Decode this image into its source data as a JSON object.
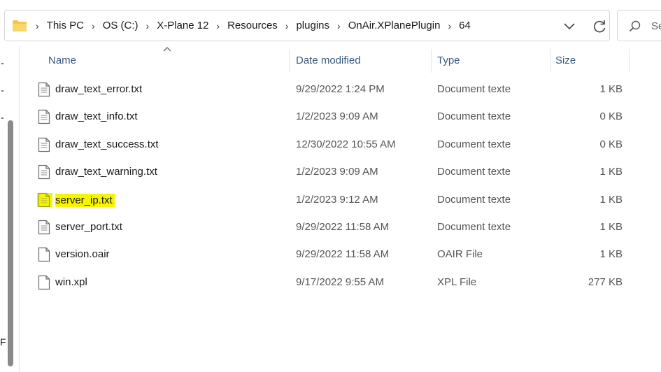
{
  "address_bar": {
    "icon": "folder-icon",
    "breadcrumbs": [
      "This PC",
      "OS (C:)",
      "X-Plane 12",
      "Resources",
      "plugins",
      "OnAir.XPlanePlugin",
      "64"
    ]
  },
  "search": {
    "placeholder": "Se"
  },
  "left_pane": {
    "clipped_text": "F"
  },
  "columns": {
    "name": "Name",
    "date_modified": "Date modified",
    "type": "Type",
    "size": "Size"
  },
  "files": [
    {
      "name": "draw_text_error.txt",
      "date": "9/29/2022 1:24 PM",
      "type": "Document texte",
      "size": "1 KB",
      "icon": "text-file-icon"
    },
    {
      "name": "draw_text_info.txt",
      "date": "1/2/2023 9:09 AM",
      "type": "Document texte",
      "size": "0 KB",
      "icon": "text-file-icon"
    },
    {
      "name": "draw_text_success.txt",
      "date": "12/30/2022 10:55 AM",
      "type": "Document texte",
      "size": "0 KB",
      "icon": "text-file-icon"
    },
    {
      "name": "draw_text_warning.txt",
      "date": "1/2/2023 9:09 AM",
      "type": "Document texte",
      "size": "1 KB",
      "icon": "text-file-icon"
    },
    {
      "name": "server_ip.txt",
      "date": "1/2/2023 9:12 AM",
      "type": "Document texte",
      "size": "1 KB",
      "icon": "text-file-icon",
      "highlighted": true
    },
    {
      "name": "server_port.txt",
      "date": "9/29/2022 11:58 AM",
      "type": "Document texte",
      "size": "1 KB",
      "icon": "text-file-icon"
    },
    {
      "name": "version.oair",
      "date": "9/29/2022 11:58 AM",
      "type": "OAIR File",
      "size": "1 KB",
      "icon": "blank-file-icon"
    },
    {
      "name": "win.xpl",
      "date": "9/17/2022 9:55 AM",
      "type": "XPL File",
      "size": "277 KB",
      "icon": "blank-file-icon"
    }
  ],
  "colors": {
    "highlight": "#f5f500",
    "header_text": "#3a5a7e",
    "folder": "#f4c542"
  }
}
